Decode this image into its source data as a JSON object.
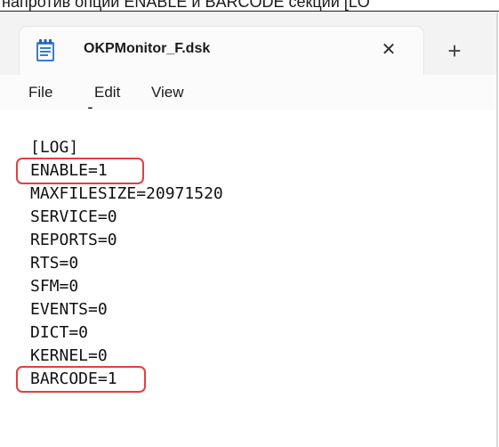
{
  "caption": {
    "text": "напротив опций ENABLE и BARCODE секции [LO"
  },
  "tab": {
    "title": "OKPMonitor_F.dsk",
    "close_symbol": "✕",
    "new_tab_symbol": "+",
    "icon": "notepad-file-icon"
  },
  "menu": {
    "items": [
      "File",
      "Edit",
      "View"
    ]
  },
  "editor": {
    "partial_line": "-",
    "lines": [
      "[LOG]",
      "ENABLE=1",
      "MAXFILESIZE=20971520",
      "SERVICE=0",
      "REPORTS=0",
      "RTS=0",
      "SFM=0",
      "EVENTS=0",
      "DICT=0",
      "KERNEL=0",
      "BARCODE=1"
    ],
    "highlighted_lines": [
      "ENABLE=1",
      "BARCODE=1"
    ]
  },
  "colors": {
    "highlight": "#e2403f",
    "tab_background": "#fbfbfb",
    "window_background": "#f3f3f3",
    "icon_blue": "#3a7bd5"
  }
}
